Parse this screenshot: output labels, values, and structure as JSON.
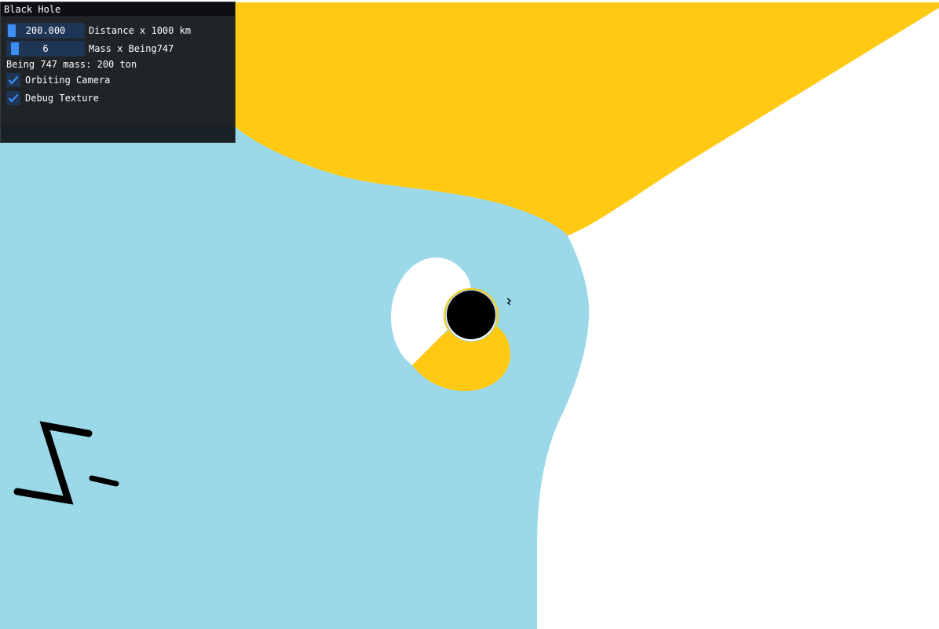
{
  "window": {
    "title": "Black Hole"
  },
  "controls": {
    "distance": {
      "value": "200.000",
      "label": "Distance x 1000 km",
      "fill": 0.0
    },
    "mass": {
      "value": "6",
      "label": "Mass x Being747",
      "fill": 0.05
    },
    "info_text": "Being 747 mass: 200 ton",
    "orbiting_camera": {
      "label": "Orbiting Camera",
      "checked": true
    },
    "debug_texture": {
      "label": "Debug Texture",
      "checked": true
    }
  },
  "scene": {
    "background_colors": {
      "sky_blue": "#9bd9e9",
      "yellow": "#ffc914",
      "white": "#ffffff",
      "black": "#000000"
    }
  },
  "colors": {
    "panel_bg": "#0d1114",
    "widget_bg": "#1f3555",
    "accent": "#3d8ef0",
    "text": "#ffffff"
  }
}
